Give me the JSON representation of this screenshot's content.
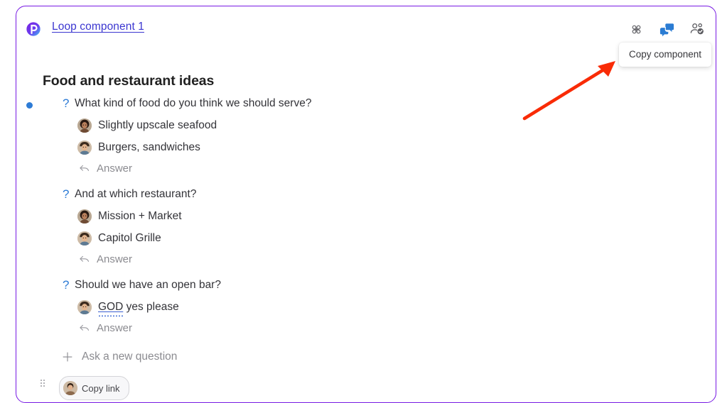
{
  "card": {
    "border_color": "#7719e3",
    "logo_icon": "loop-logo-icon",
    "title": "Loop component 1"
  },
  "header": {
    "actions": [
      {
        "name": "apps-grid-icon",
        "label": "Apps"
      },
      {
        "name": "comments-icon",
        "label": "Comments"
      },
      {
        "name": "people-check-icon",
        "label": "Sharing"
      }
    ]
  },
  "tooltip": {
    "text": "Copy component"
  },
  "poll": {
    "heading": "Food and restaurant ideas",
    "bullet_color": "#2e7cd6",
    "question_marker": "?",
    "reply_label": "Answer",
    "add_question_label": "Ask a new question",
    "questions": [
      {
        "text": "What kind of food do you think we should serve?",
        "answers": [
          {
            "author_avatar": "avatar-woman",
            "text": "Slightly upscale seafood",
            "misspelled": ""
          },
          {
            "author_avatar": "avatar-man",
            "text": "Burgers, sandwiches",
            "misspelled": ""
          }
        ]
      },
      {
        "text": "And at which restaurant?",
        "answers": [
          {
            "author_avatar": "avatar-woman",
            "text": "Mission + Market",
            "misspelled": ""
          },
          {
            "author_avatar": "avatar-man",
            "text": "Capitol Grille",
            "misspelled": ""
          }
        ]
      },
      {
        "text": "Should we have an open bar?",
        "answers": [
          {
            "author_avatar": "avatar-man",
            "text": " yes please",
            "misspelled": "GOD"
          }
        ]
      }
    ]
  },
  "presence": {
    "label": "Copy link",
    "avatar": "avatar-man"
  },
  "annotation": {
    "arrow_color": "#f92b06",
    "points_to": "comments-icon"
  }
}
